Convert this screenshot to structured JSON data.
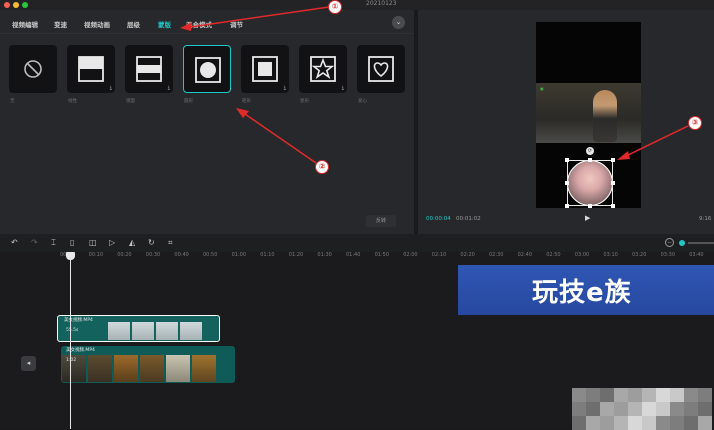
{
  "window": {
    "title": "20210123"
  },
  "tabs": [
    {
      "label": "视频编辑"
    },
    {
      "label": "变速"
    },
    {
      "label": "视频动画"
    },
    {
      "label": "层级"
    },
    {
      "label": "蒙版"
    },
    {
      "label": "混合模式"
    },
    {
      "label": "调节"
    }
  ],
  "masks": [
    {
      "label": "无",
      "icon": "none-icon"
    },
    {
      "label": "线性",
      "icon": "linear-mask-icon"
    },
    {
      "label": "镜面",
      "icon": "mirror-mask-icon"
    },
    {
      "label": "圆形",
      "icon": "circle-mask-icon"
    },
    {
      "label": "矩形",
      "icon": "rectangle-mask-icon"
    },
    {
      "label": "星形",
      "icon": "star-mask-icon"
    },
    {
      "label": "爱心",
      "icon": "heart-mask-icon"
    }
  ],
  "mask_panel": {
    "flip_label": "反转"
  },
  "player": {
    "current_time": "00:00:04",
    "total_time": "00:01:02",
    "ratio": "9:16"
  },
  "timeline": {
    "ticks": [
      "00:00",
      "00:10",
      "00:20",
      "00:30",
      "00:40",
      "00:50",
      "01:00",
      "01:10",
      "01:20",
      "01:30",
      "01:40",
      "01:50",
      "02:00",
      "02:10",
      "02:20",
      "02:30",
      "02:40",
      "02:50",
      "03:00",
      "03:10",
      "03:20",
      "03:30",
      "03:40",
      "03:50"
    ],
    "banner_text": "玩技e族",
    "clip1": {
      "name": "美女视频.MP4",
      "duration": "55.5s"
    },
    "clip2": {
      "name": "美女视频.MP4",
      "duration": "1:02"
    }
  },
  "annotations": [
    "①",
    "②",
    "③"
  ],
  "colors": {
    "accent": "#1fc8c6",
    "arrow": "#e02a2a",
    "banner": "#2c52ad"
  }
}
